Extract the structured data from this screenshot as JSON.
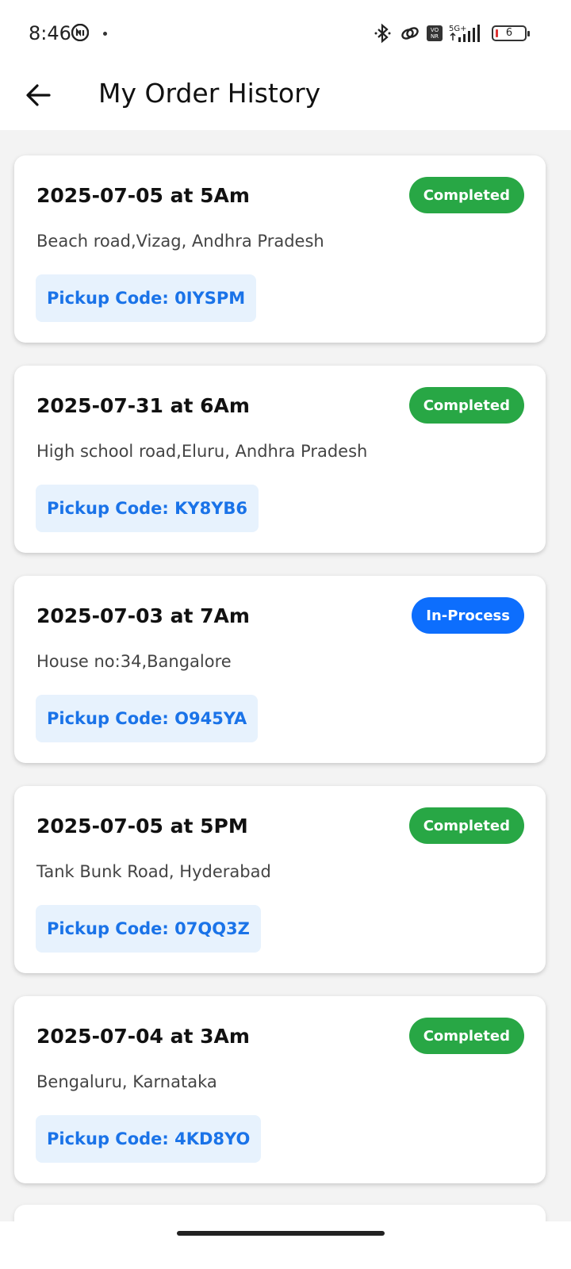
{
  "status_bar": {
    "time": "8:46",
    "battery_level": "6",
    "network": "5G+",
    "icons": [
      "app-notification-icon",
      "bluetooth-icon",
      "link-icon",
      "vonr-icon",
      "signal-icon",
      "battery-icon"
    ]
  },
  "header": {
    "back_icon": "arrow-left-icon",
    "title": "My Order History"
  },
  "orders": [
    {
      "datetime": "2025-07-05 at 5Am",
      "address": "Beach road,Vizag, Andhra Pradesh",
      "status": "Completed",
      "pickup_code": "Pickup Code: 0IYSPM"
    },
    {
      "datetime": "2025-07-31 at 6Am",
      "address": "High school road,Eluru, Andhra Pradesh",
      "status": "Completed",
      "pickup_code": "Pickup Code: KY8YB6"
    },
    {
      "datetime": "2025-07-03 at 7Am",
      "address": "House no:34,Bangalore",
      "status": "In-Process",
      "pickup_code": "Pickup Code: O945YA"
    },
    {
      "datetime": "2025-07-05 at 5PM",
      "address": "Tank Bunk Road, Hyderabad",
      "status": "Completed",
      "pickup_code": "Pickup Code: 07QQ3Z"
    },
    {
      "datetime": "2025-07-04 at 3Am",
      "address": "Bengaluru, Karnataka",
      "status": "Completed",
      "pickup_code": "Pickup Code: 4KD8YO"
    }
  ],
  "colors": {
    "completed": "#28a745",
    "in_process": "#0d6efd",
    "code_text": "#1a73e8",
    "code_bg": "#e7f2fd"
  }
}
